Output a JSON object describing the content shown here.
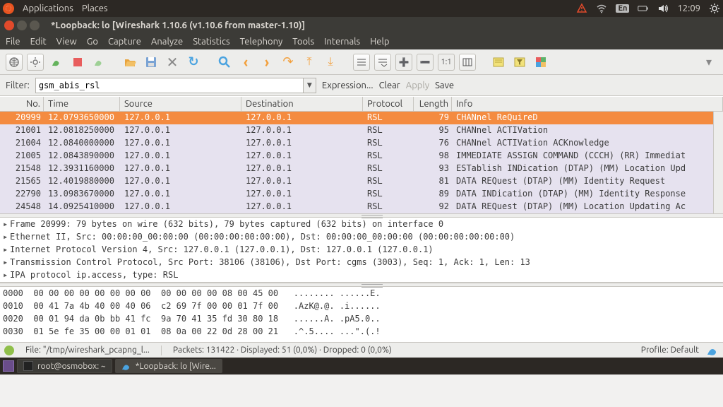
{
  "topbar": {
    "app_menu": "Applications",
    "places_menu": "Places",
    "lang": "En",
    "clock": "12:09"
  },
  "window": {
    "title": "*Loopback: lo   [Wireshark 1.10.6  (v1.10.6 from master-1.10)]"
  },
  "menubar": [
    "File",
    "Edit",
    "View",
    "Go",
    "Capture",
    "Analyze",
    "Statistics",
    "Telephony",
    "Tools",
    "Internals",
    "Help"
  ],
  "filter": {
    "label": "Filter:",
    "value": "gsm_abis_rsl",
    "expression": "Expression...",
    "clear": "Clear",
    "apply": "Apply",
    "save": "Save"
  },
  "columns": {
    "no": "No.",
    "time": "Time",
    "src": "Source",
    "dst": "Destination",
    "proto": "Protocol",
    "len": "Length",
    "info": "Info"
  },
  "packets": [
    {
      "no": "20999",
      "time": "12.0793650000",
      "src": "127.0.0.1",
      "dst": "127.0.0.1",
      "proto": "RSL",
      "len": "79",
      "info": "CHANnel ReQuireD",
      "sel": true
    },
    {
      "no": "21001",
      "time": "12.0818250000",
      "src": "127.0.0.1",
      "dst": "127.0.0.1",
      "proto": "RSL",
      "len": "95",
      "info": "CHANnel ACTIVation"
    },
    {
      "no": "21004",
      "time": "12.0840000000",
      "src": "127.0.0.1",
      "dst": "127.0.0.1",
      "proto": "RSL",
      "len": "76",
      "info": "CHANnel ACTIVation ACKnowledge"
    },
    {
      "no": "21005",
      "time": "12.0843890000",
      "src": "127.0.0.1",
      "dst": "127.0.0.1",
      "proto": "RSL",
      "len": "98",
      "info": "IMMEDIATE ASSIGN COMMAND (CCCH) (RR) Immediat"
    },
    {
      "no": "21548",
      "time": "12.3931160000",
      "src": "127.0.0.1",
      "dst": "127.0.0.1",
      "proto": "RSL",
      "len": "93",
      "info": "ESTablish INDication (DTAP) (MM) Location Upd"
    },
    {
      "no": "21565",
      "time": "12.4019880000",
      "src": "127.0.0.1",
      "dst": "127.0.0.1",
      "proto": "RSL",
      "len": "81",
      "info": "DATA REQuest (DTAP) (MM) Identity Request"
    },
    {
      "no": "22790",
      "time": "13.0983670000",
      "src": "127.0.0.1",
      "dst": "127.0.0.1",
      "proto": "RSL",
      "len": "89",
      "info": "DATA INDication (DTAP) (MM) Identity Response"
    },
    {
      "no": "24548",
      "time": "14.0925410000",
      "src": "127.0.0.1",
      "dst": "127.0.0.1",
      "proto": "RSL",
      "len": "92",
      "info": "DATA REQuest (DTAP) (MM) Location Updating Ac"
    }
  ],
  "details": [
    "Frame 20999: 79 bytes on wire (632 bits), 79 bytes captured (632 bits) on interface 0",
    "Ethernet II, Src: 00:00:00_00:00:00 (00:00:00:00:00:00), Dst: 00:00:00_00:00:00 (00:00:00:00:00:00)",
    "Internet Protocol Version 4, Src: 127.0.0.1 (127.0.0.1), Dst: 127.0.0.1 (127.0.0.1)",
    "Transmission Control Protocol, Src Port: 38106 (38106), Dst Port: cgms (3003), Seq: 1, Ack: 1, Len: 13",
    "IPA protocol ip.access, type: RSL"
  ],
  "hex": [
    {
      "off": "0000",
      "b": "00 00 00 00 00 00 00 00  00 00 00 00 08 00 45 00",
      "a": "........ ......E."
    },
    {
      "off": "0010",
      "b": "00 41 7a 4b 40 00 40 06  c2 69 7f 00 00 01 7f 00",
      "a": ".AzK@.@. .i......"
    },
    {
      "off": "0020",
      "b": "00 01 94 da 0b bb 41 fc  9a 70 41 35 fd 30 80 18",
      "a": "......A. .pA5.0.."
    },
    {
      "off": "0030",
      "b": "01 5e fe 35 00 00 01 01  08 0a 00 22 0d 28 00 21",
      "a": ".^.5.... ...\".(.!"
    }
  ],
  "status": {
    "file": "File: \"/tmp/wireshark_pcapng_l...",
    "counts": "Packets: 131422 · Displayed: 51 (0,0%) · Dropped: 0 (0,0%)",
    "profile": "Profile: Default"
  },
  "taskbar": {
    "term": "root@osmobox: ~",
    "wireshark": "*Loopback: lo   [Wire..."
  }
}
